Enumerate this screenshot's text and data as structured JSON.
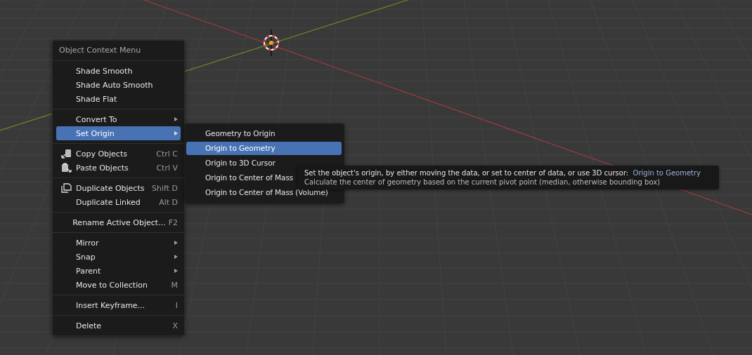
{
  "context_menu": {
    "title": "Object Context Menu",
    "sections": [
      {
        "items": [
          {
            "label": "Shade Smooth",
            "kind": "item",
            "submenu": false,
            "selected": false
          },
          {
            "label": "Shade Auto Smooth",
            "kind": "item",
            "submenu": false,
            "selected": false
          },
          {
            "label": "Shade Flat",
            "kind": "item",
            "submenu": false,
            "selected": false
          }
        ]
      },
      {
        "items": [
          {
            "label": "Convert To",
            "kind": "item",
            "submenu": true,
            "selected": false
          },
          {
            "label": "Set Origin",
            "kind": "item",
            "submenu": true,
            "selected": true
          }
        ]
      },
      {
        "items": [
          {
            "label": "Copy Objects",
            "shortcut": "Ctrl C",
            "kind": "copy",
            "submenu": false,
            "selected": false
          },
          {
            "label": "Paste Objects",
            "shortcut": "Ctrl V",
            "kind": "paste",
            "submenu": false,
            "selected": false
          }
        ]
      },
      {
        "items": [
          {
            "label": "Duplicate Objects",
            "shortcut": "Shift D",
            "kind": "duplicate",
            "submenu": false,
            "selected": false
          },
          {
            "label": "Duplicate Linked",
            "shortcut": "Alt D",
            "kind": "item",
            "submenu": false,
            "selected": false
          }
        ]
      },
      {
        "items": [
          {
            "label": "Rename Active Object...",
            "shortcut": "F2",
            "kind": "item",
            "submenu": false,
            "selected": false
          }
        ]
      },
      {
        "items": [
          {
            "label": "Mirror",
            "kind": "item",
            "submenu": true,
            "selected": false
          },
          {
            "label": "Snap",
            "kind": "item",
            "submenu": true,
            "selected": false
          },
          {
            "label": "Parent",
            "kind": "item",
            "submenu": true,
            "selected": false
          },
          {
            "label": "Move to Collection",
            "shortcut": "M",
            "kind": "item",
            "submenu": false,
            "selected": false
          }
        ]
      },
      {
        "items": [
          {
            "label": "Insert Keyframe...",
            "shortcut": "I",
            "kind": "item",
            "submenu": false,
            "selected": false
          }
        ]
      },
      {
        "items": [
          {
            "label": "Delete",
            "shortcut": "X",
            "kind": "item",
            "submenu": false,
            "selected": false
          }
        ]
      }
    ]
  },
  "submenu": {
    "items": [
      {
        "label": "Geometry to Origin",
        "selected": false
      },
      {
        "label": "Origin to Geometry",
        "selected": true
      },
      {
        "label": "Origin to 3D Cursor",
        "selected": false
      },
      {
        "label": "Origin to Center of Mass",
        "selected": false
      },
      {
        "label": "Origin to Center of Mass (Volume)",
        "selected": false
      }
    ]
  },
  "tooltip": {
    "description": "Set the object's origin, by either moving the data, or set to center of data, or use 3D cursor:",
    "operator": "Origin to Geometry",
    "detail": "Calculate the center of geometry based on the current pivot point (median, otherwise bounding box)"
  }
}
